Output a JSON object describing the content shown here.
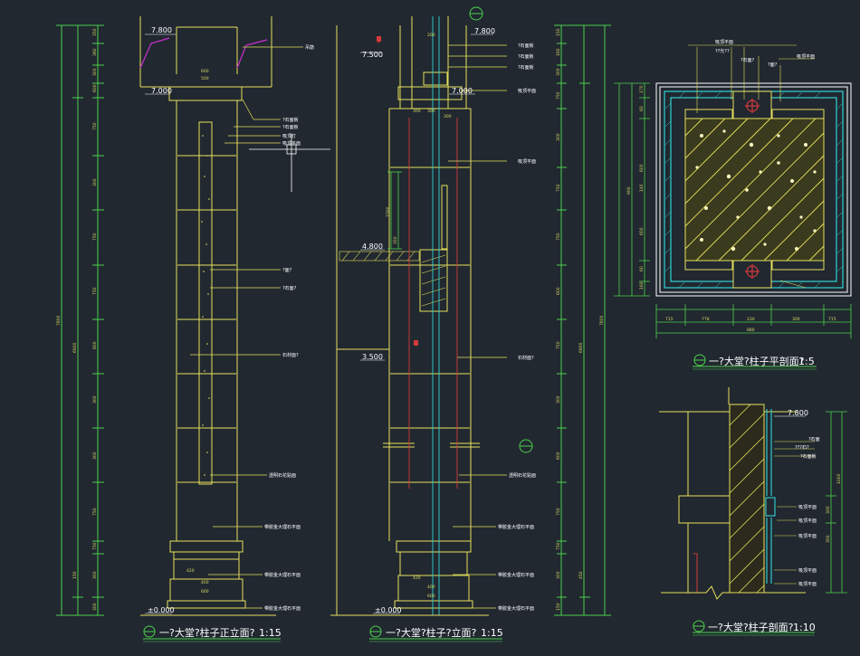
{
  "colors": {
    "background": "#212830",
    "dimension_line": "#4cd14c",
    "outline": "#e6e05a",
    "marker": "#4cd14c",
    "hatch": "#e6e05a",
    "accent": "#d63a3a",
    "cyan": "#2fd3d3",
    "magenta": "#cc2fd1",
    "text": "#ffffff"
  },
  "drawings": {
    "front": {
      "title": "一?大堂?柱子正立面?",
      "scale": "1:15",
      "overall_dims": [
        "7800",
        "6900"
      ]
    },
    "side": {
      "title": "一?大堂?柱子?立面?",
      "scale": "1:15"
    },
    "plan": {
      "title": "一?大堂?柱子平剖面?",
      "scale": "1:5"
    },
    "section": {
      "title": "一?大堂?柱子剖面?",
      "scale": "1:10"
    }
  },
  "levels": {
    "front_top": "7.800",
    "front_ceiling": "7.000",
    "front_floor": "±0.000",
    "side_top": "7.800",
    "side_ceiling1": "7.500",
    "side_ceiling2": "7.000",
    "side_beam": "4.800",
    "side_mid": "3.500",
    "side_floor": "±0.000",
    "section_top": "7.800"
  },
  "annotations": {
    "front": [
      "吊筋",
      "?石面板",
      "?石面板",
      "吸顶灯",
      "吸顶平面",
      "?面?",
      "?石面?",
      "石材面?",
      "透明石花贴面",
      "带胶金大理石平面",
      "带胶金大理石平面",
      "带胶金大理石平面"
    ],
    "side": [
      "?石面板",
      "?石面板",
      "?石面板",
      "吸顶平面",
      "吸顶平面",
      "石材面?",
      "透明石花贴面",
      "带胶金大理石平面",
      "带胶金大理石平面",
      "带胶金大理石平面"
    ],
    "plan": [
      "吸顶平面",
      "??光??",
      "?石面?",
      "?面?",
      "吸顶平面"
    ],
    "section": [
      "?石面",
      "???石?",
      "?石面板",
      "吸顶平面",
      "吸顶平面",
      "吸顶平面",
      "吸顶平面",
      "吸顶平面"
    ]
  },
  "dims": {
    "front_left": [
      "7800",
      "6900",
      "350",
      "360",
      "300",
      "600",
      "750",
      "300",
      "750",
      "750",
      "600",
      "300",
      "300",
      "750",
      "750",
      "300",
      "300",
      "150"
    ],
    "front_widths": [
      "600",
      "500",
      "420",
      "400",
      "600"
    ],
    "side_widths": [
      "200",
      "300",
      "300",
      "300",
      "420",
      "400",
      "600"
    ],
    "side_vert": [
      "1500",
      "350"
    ],
    "right_mid": [
      "7800",
      "6900",
      "150",
      "160",
      "300",
      "750",
      "300",
      "750",
      "750",
      "600",
      "750",
      "300",
      "600",
      "750",
      "750",
      "300",
      "450",
      "150"
    ],
    "plan_bottom": [
      "715",
      "778",
      "230",
      "300",
      "715",
      "880"
    ],
    "plan_left": [
      "170",
      "60",
      "600",
      "140",
      "600",
      "60",
      "160",
      "900"
    ],
    "section_right": [
      "1000",
      "300",
      "300"
    ]
  }
}
